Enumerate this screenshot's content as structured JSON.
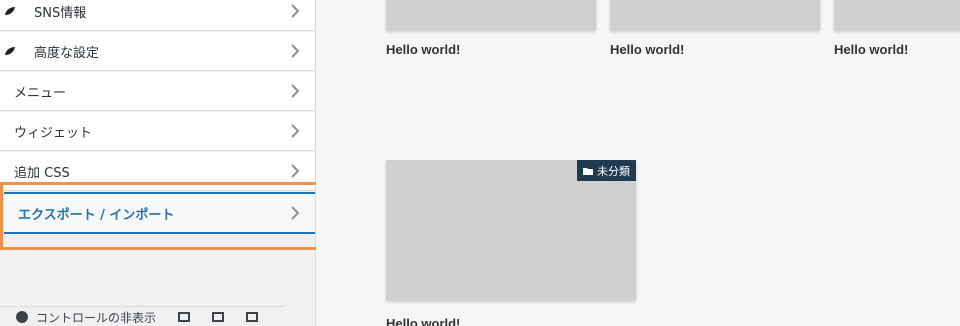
{
  "sidebar": {
    "items": [
      {
        "label": "SNS情報"
      },
      {
        "label": "高度な設定"
      },
      {
        "label": "メニュー"
      },
      {
        "label": "ウィジェット"
      },
      {
        "label": "追加 CSS"
      },
      {
        "label": "エクスポート / インポート"
      }
    ],
    "footer": {
      "hide_controls_label": "コントロールの非表示"
    }
  },
  "preview": {
    "cards": [
      {
        "title": "Hello world!"
      },
      {
        "title": "Hello world!"
      },
      {
        "title": "Hello world!"
      },
      {
        "title": "Hello world!",
        "category": "未分類"
      }
    ]
  },
  "colors": {
    "accent": "#2271b1",
    "highlight": "#f0924b",
    "badge": "#1e3b4f"
  }
}
